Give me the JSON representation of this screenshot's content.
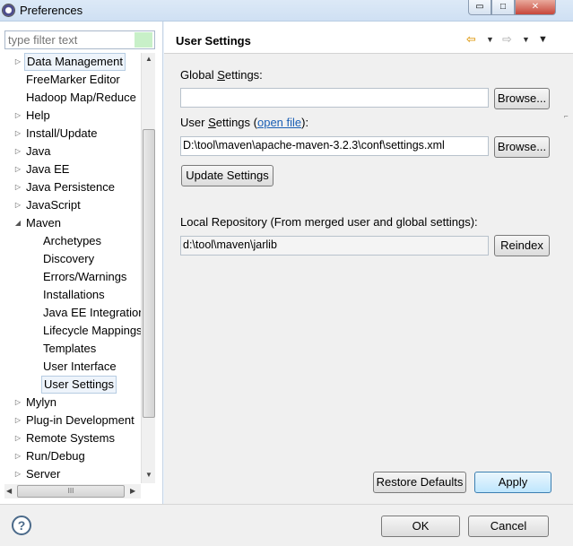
{
  "window": {
    "title": "Preferences",
    "minimize_glyph": "▭",
    "maximize_glyph": "□",
    "close_glyph": "✕"
  },
  "sidebar": {
    "filter_placeholder": "type filter text",
    "items": [
      {
        "label": "Data Management",
        "level": 0,
        "expander": "▷"
      },
      {
        "label": "FreeMarker Editor",
        "level": 0,
        "expander": ""
      },
      {
        "label": "Hadoop Map/Reduce",
        "level": 0,
        "expander": ""
      },
      {
        "label": "Help",
        "level": 0,
        "expander": "▷"
      },
      {
        "label": "Install/Update",
        "level": 0,
        "expander": "▷"
      },
      {
        "label": "Java",
        "level": 0,
        "expander": "▷"
      },
      {
        "label": "Java EE",
        "level": 0,
        "expander": "▷"
      },
      {
        "label": "Java Persistence",
        "level": 0,
        "expander": "▷"
      },
      {
        "label": "JavaScript",
        "level": 0,
        "expander": "▷"
      },
      {
        "label": "Maven",
        "level": 0,
        "expander": "◢"
      },
      {
        "label": "Archetypes",
        "level": 1,
        "expander": ""
      },
      {
        "label": "Discovery",
        "level": 1,
        "expander": ""
      },
      {
        "label": "Errors/Warnings",
        "level": 1,
        "expander": ""
      },
      {
        "label": "Installations",
        "level": 1,
        "expander": ""
      },
      {
        "label": "Java EE Integration",
        "level": 1,
        "expander": ""
      },
      {
        "label": "Lifecycle Mappings",
        "level": 1,
        "expander": ""
      },
      {
        "label": "Templates",
        "level": 1,
        "expander": ""
      },
      {
        "label": "User Interface",
        "level": 1,
        "expander": ""
      },
      {
        "label": "User Settings",
        "level": 1,
        "expander": "",
        "selected": true
      },
      {
        "label": "Mylyn",
        "level": 0,
        "expander": "▷"
      },
      {
        "label": "Plug-in Development",
        "level": 0,
        "expander": "▷"
      },
      {
        "label": "Remote Systems",
        "level": 0,
        "expander": "▷"
      },
      {
        "label": "Run/Debug",
        "level": 0,
        "expander": "▷"
      },
      {
        "label": "Server",
        "level": 0,
        "expander": "▷"
      }
    ],
    "scroll_up_glyph": "▲",
    "scroll_down_glyph": "▼",
    "scroll_left_glyph": "◀",
    "scroll_right_glyph": "▶",
    "hthumb_glyph": "III"
  },
  "header": {
    "title": "User Settings",
    "back_glyph": "⇦",
    "dropdown_glyph": "▼",
    "forward_glyph": "⇨",
    "menu_glyph": "▼"
  },
  "form": {
    "global_settings_label_pre": "Global ",
    "global_settings_label_u": "S",
    "global_settings_label_post": "ettings:",
    "global_settings_value": "",
    "user_settings_label_pre": "User ",
    "user_settings_label_u": "S",
    "user_settings_label_post": "ettings (",
    "open_file_link": "open file",
    "user_settings_label_end": "):",
    "user_settings_value": "D:\\tool\\maven\\apache-maven-3.2.3\\conf\\settings.xml",
    "browse_label": "Browse...",
    "update_settings_label": "Update Settings",
    "local_repo_label": "Local Repository (From merged user and global settings):",
    "local_repo_value": "d:\\tool\\maven\\jarlib",
    "reindex_label": "Reindex",
    "restore_defaults_label": "Restore Defaults",
    "apply_label": "Apply"
  },
  "footer": {
    "help_glyph": "?",
    "ok_label": "OK",
    "cancel_label": "Cancel"
  }
}
